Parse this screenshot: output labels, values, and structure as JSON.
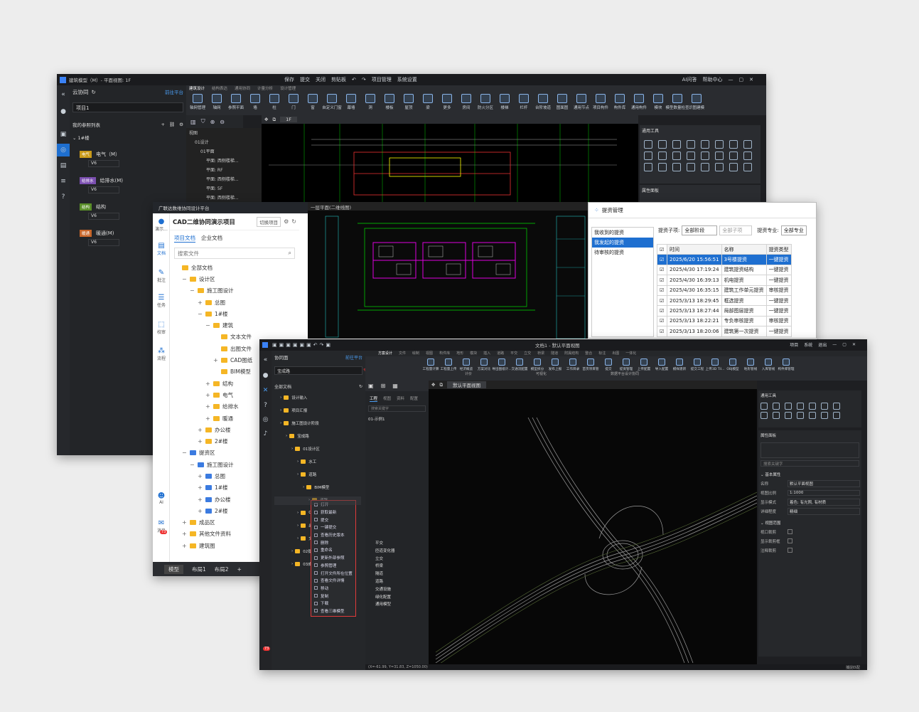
{
  "w1": {
    "title": "建筑模型（M）- 平面视图: 1F",
    "toolbar": [
      "保存",
      "提交",
      "关闭",
      "剪贴板",
      "项目管理",
      "系统设置"
    ],
    "right_links": [
      "AI问答",
      "帮助中心"
    ],
    "tabs": [
      "建筑设计",
      "结构表达",
      "通用协同",
      "计量分析",
      "设计管理"
    ],
    "panel_title": "云协同",
    "goto": "前往平台",
    "project": "项目1",
    "ref_list": "我的参照列表",
    "building": "1#楼",
    "disciplines": [
      {
        "tag": "电气",
        "name": "电气（M）",
        "ver": "V6",
        "color": "#c99a1a"
      },
      {
        "tag": "给排水",
        "name": "给排水(M)",
        "ver": "V6",
        "color": "#7b4fb0"
      },
      {
        "tag": "结构",
        "name": "结构",
        "ver": "V6",
        "color": "#5a8f2a"
      },
      {
        "tag": "暖通",
        "name": "暖通(M)",
        "ver": "V6",
        "color": "#c8662a"
      }
    ],
    "ribbon": [
      "轴网管理",
      "轴网",
      "参照平面",
      "墙",
      "柱",
      "门",
      "窗",
      "自定义门窗",
      "幕墙",
      "洞",
      "楼板",
      "屋顶",
      "梁",
      "更多",
      "房间",
      "防火分区",
      "楼梯",
      "栏杆",
      "台阶坡道",
      "图面图",
      "通用节点",
      "项目构件",
      "构件库",
      "通用构件",
      "模块",
      "模型数量检查",
      "识图建模"
    ],
    "tree": [
      "视图",
      "01设计",
      "01平面",
      "平面: 西侧楼梯...",
      "平面: RF",
      "平面: 西侧楼梯...",
      "平面: 5F",
      "平面: 西侧楼梯..."
    ],
    "tab": "1F",
    "tool_title": "通用工具",
    "prop_title": "属性面板"
  },
  "w2": {
    "title": "广联达数维协同设计平台",
    "project": "CAD二维协同演示项目",
    "switch": "切换项目",
    "nav": [
      "演示...",
      "文档",
      "批注",
      "任务",
      "校审",
      "流程",
      "AI",
      "消息"
    ],
    "badge": "73",
    "doc_tabs": [
      "项目文档",
      "企业文档"
    ],
    "search_placeholder": "搜索文件",
    "files": [
      {
        "lv": 0,
        "name": "全部文档",
        "t": "y",
        "pm": ""
      },
      {
        "lv": 1,
        "name": "设计区",
        "t": "y",
        "pm": "−"
      },
      {
        "lv": 2,
        "name": "施工图设计",
        "t": "y",
        "pm": "−"
      },
      {
        "lv": 3,
        "name": "总图",
        "t": "y",
        "pm": "+"
      },
      {
        "lv": 3,
        "name": "1#楼",
        "t": "y",
        "pm": "−"
      },
      {
        "lv": 4,
        "name": "建筑",
        "t": "y",
        "pm": "−"
      },
      {
        "lv": 5,
        "name": "文本文件",
        "t": "y",
        "pm": ""
      },
      {
        "lv": 5,
        "name": "出图文件",
        "t": "y",
        "pm": ""
      },
      {
        "lv": 5,
        "name": "CAD图纸",
        "t": "y",
        "pm": "+"
      },
      {
        "lv": 5,
        "name": "BIM模型",
        "t": "y",
        "pm": ""
      },
      {
        "lv": 4,
        "name": "结构",
        "t": "y",
        "pm": "+"
      },
      {
        "lv": 4,
        "name": "电气",
        "t": "y",
        "pm": "+"
      },
      {
        "lv": 4,
        "name": "给排水",
        "t": "y",
        "pm": "+"
      },
      {
        "lv": 4,
        "name": "暖通",
        "t": "y",
        "pm": "+"
      },
      {
        "lv": 3,
        "name": "办公楼",
        "t": "y",
        "pm": "+"
      },
      {
        "lv": 3,
        "name": "2#楼",
        "t": "y",
        "pm": "+"
      },
      {
        "lv": 1,
        "name": "提资区",
        "t": "b",
        "pm": "−"
      },
      {
        "lv": 2,
        "name": "施工图设计",
        "t": "b",
        "pm": "−"
      },
      {
        "lv": 3,
        "name": "总图",
        "t": "b",
        "pm": "+"
      },
      {
        "lv": 3,
        "name": "1#楼",
        "t": "b",
        "pm": "+"
      },
      {
        "lv": 3,
        "name": "办公楼",
        "t": "b",
        "pm": "+"
      },
      {
        "lv": 3,
        "name": "2#楼",
        "t": "b",
        "pm": "+"
      },
      {
        "lv": 1,
        "name": "成品区",
        "t": "y",
        "pm": "+"
      },
      {
        "lv": 1,
        "name": "其他文件资料",
        "t": "y",
        "pm": "+"
      },
      {
        "lv": 1,
        "name": "建筑图",
        "t": "y",
        "pm": "+"
      }
    ],
    "bottom_tabs": [
      "模型",
      "布局1",
      "布局2",
      "+"
    ],
    "drawing_tab": "一层平面(二维线图)",
    "tiz": {
      "title": "提资管理",
      "left": [
        "我收到的提资",
        "我发起的提资",
        "待审核的提资"
      ],
      "filter_stage_label": "提资子项:",
      "filter_stage": "全部阶段",
      "filter_sub": "全部子项",
      "filter_major_label": "提资专业:",
      "filter_major": "全部专业",
      "cols": [
        "时间",
        "名称",
        "提资类型"
      ],
      "rows": [
        [
          "2025/6/20 15:56:51",
          "3号楼提资",
          "一键提资"
        ],
        [
          "2025/4/30 17:19:24",
          "建筑提资结构",
          "一键提资"
        ],
        [
          "2025/4/30 16:39:13",
          "机电提资",
          "一键提资"
        ],
        [
          "2025/4/30 16:35:15",
          "建筑工作单元提资",
          "审核提资"
        ],
        [
          "2025/3/13 18:29:45",
          "框选提资",
          "一键提资"
        ],
        [
          "2025/3/13 18:27:44",
          "局部图层提资",
          "一键提资"
        ],
        [
          "2025/3/13 18:22:21",
          "专负审核提资",
          "审核提资"
        ],
        [
          "2025/3/13 18:20:06",
          "建筑第一次提资",
          "一键提资"
        ]
      ]
    }
  },
  "w3": {
    "title": "文档1 - 默认平面视图",
    "right_links": [
      "项目",
      "系统",
      "退出"
    ],
    "tabs": [
      "方案设计",
      "文件",
      "绘制",
      "视图",
      "构件库",
      "地形",
      "模块",
      "插入",
      "道路",
      "平交",
      "立交",
      "桥梁",
      "隧道",
      "附属结构",
      "整合",
      "标注",
      "出图",
      "一体化"
    ],
    "ribbon": [
      "工程量计算",
      "工程量上传",
      "经济概览",
      "方案对比",
      "导出图纸计...",
      "交通流配置",
      "模型拆分",
      "发布上报",
      "工作目录",
      "首页项目管",
      "提交",
      "提资管理",
      "上传配置",
      "导入配置",
      "模样建新",
      "提交工程",
      "上传3D Til...",
      "OBJ模型",
      "地形管线",
      "入库管线",
      "构件库管理"
    ],
    "groups": [
      "计价",
      "可视化",
      "数据平台设计协同"
    ],
    "panel_title": "协同面",
    "goto": "前往平台",
    "project": "宝成路",
    "all_docs": "全部文档",
    "files": [
      {
        "lv": 1,
        "name": "设计输入"
      },
      {
        "lv": 1,
        "name": "项目汇报"
      },
      {
        "lv": 1,
        "name": "施工图设计阶段"
      },
      {
        "lv": 2,
        "name": "宝成路"
      },
      {
        "lv": 3,
        "name": "01设计区"
      },
      {
        "lv": 4,
        "name": "水工"
      },
      {
        "lv": 4,
        "name": "道路"
      },
      {
        "lv": 5,
        "name": "BIM模型"
      },
      {
        "lv": 6,
        "name": "道路..."
      },
      {
        "lv": 4,
        "name": "CAD"
      },
      {
        "lv": 4,
        "name": "出图"
      },
      {
        "lv": 4,
        "name": "文本"
      },
      {
        "lv": 3,
        "name": "02提资区"
      },
      {
        "lv": 3,
        "name": "03成品区"
      }
    ],
    "menu": [
      "打开",
      "获取最新",
      "提交",
      "一键提交",
      "查看历史版本",
      "删除",
      "重命名",
      "更新外部参照",
      "参照管理",
      "打开文件所在位置",
      "查看文件详情",
      "移动",
      "复制",
      "下载",
      "查看三维模型"
    ],
    "mid_tabs": [
      "工程",
      "视图",
      "资料",
      "配置"
    ],
    "mid_search": "搜索关键字",
    "mid_tree_top": "01-示例1",
    "mid_tree": [
      "平交",
      "匝道变化器",
      "立交",
      "桥梁",
      "隧道",
      "道路",
      "交通设施",
      "绿化配置",
      "通用模型"
    ],
    "view_tab": "默认平面视图",
    "tool_title": "通用工具",
    "prop_title": "属性面板",
    "prop_placeholder": "搜索关键字",
    "prop_group": "基本属性",
    "props": [
      [
        "名称",
        "默认平面视图"
      ],
      [
        "视图比例",
        "1:1000"
      ],
      [
        "显示模式",
        "着色: 有光照, 有材质"
      ],
      [
        "详细程度",
        "精细"
      ]
    ],
    "range_group": "视图范围",
    "range_props": [
      "视口裁剪",
      "显示裁剪框",
      "注释裁剪"
    ],
    "status": "(X=-61.99, Y=31.83, Z=1050.00)",
    "status_right": "捕捉匹配",
    "badge": "73"
  },
  "colors": {
    "accent": "#1e6fd0",
    "menu_border": "#e03a3a",
    "road": "#9a9a9a",
    "green": "#00d000",
    "magenta": "#e000e0"
  }
}
